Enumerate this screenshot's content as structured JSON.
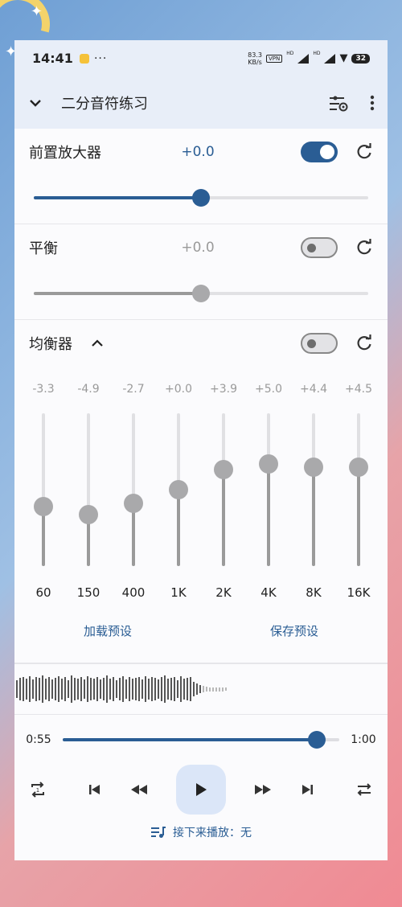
{
  "status_bar": {
    "time": "14:41",
    "net_speed_value": "83.3",
    "net_speed_unit": "KB/s",
    "vpn": "VPN",
    "hd1": "HD",
    "hd2": "HD",
    "battery": "32"
  },
  "toolbar": {
    "title": "二分音符练习",
    "icons": [
      "chevron-down-icon",
      "equalizer-settings-icon",
      "more-vertical-icon"
    ]
  },
  "preamp": {
    "label": "前置放大器",
    "value": "+0.0",
    "enabled": true,
    "slider_fraction": 0.5
  },
  "balance": {
    "label": "平衡",
    "value": "+0.0",
    "enabled": false,
    "slider_fraction": 0.5
  },
  "equalizer": {
    "label": "均衡器",
    "enabled": false,
    "range_db": [
      -15,
      15
    ],
    "bands": [
      {
        "freq": "60",
        "gain_label": "-3.3",
        "gain": -3.3
      },
      {
        "freq": "150",
        "gain_label": "-4.9",
        "gain": -4.9
      },
      {
        "freq": "400",
        "gain_label": "-2.7",
        "gain": -2.7
      },
      {
        "freq": "1K",
        "gain_label": "+0.0",
        "gain": 0.0
      },
      {
        "freq": "2K",
        "gain_label": "+3.9",
        "gain": 3.9
      },
      {
        "freq": "4K",
        "gain_label": "+5.0",
        "gain": 5.0
      },
      {
        "freq": "8K",
        "gain_label": "+4.4",
        "gain": 4.4
      },
      {
        "freq": "16K",
        "gain_label": "+4.5",
        "gain": 4.5
      }
    ],
    "load_preset": "加载预设",
    "save_preset": "保存预设"
  },
  "player": {
    "elapsed": "0:55",
    "total": "1:00",
    "progress_fraction": 0.92,
    "up_next_label": "接下来播放：无"
  },
  "colors": {
    "accent": "#2a5d94",
    "inactive": "#9a9a9a"
  }
}
